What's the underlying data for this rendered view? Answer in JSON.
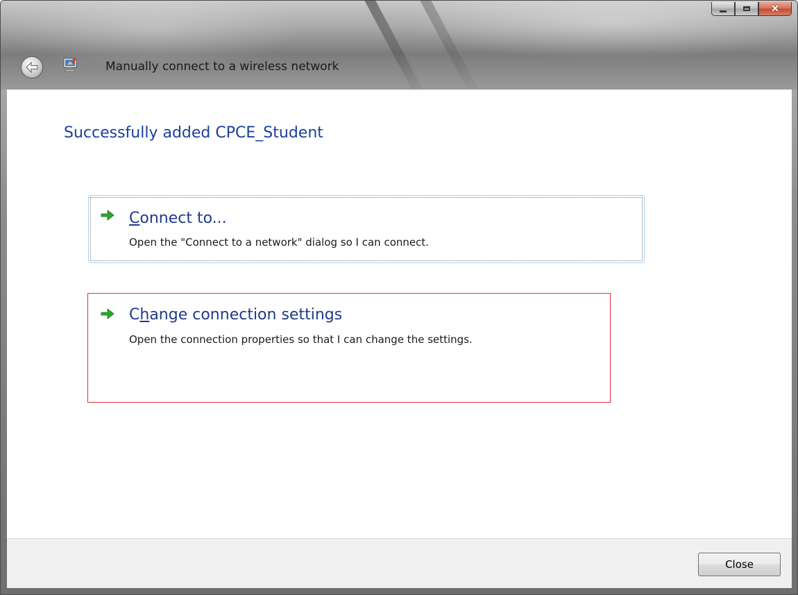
{
  "window": {
    "title": "Manually connect to a wireless network"
  },
  "icons": {
    "back": "back-arrow-icon",
    "app": "network-wizard-icon",
    "command_arrow": "green-arrow-icon"
  },
  "content": {
    "heading": "Successfully added CPCE_Student",
    "commands": [
      {
        "title_pre": "",
        "title_accel": "C",
        "title_post": "onnect to...",
        "description": "Open the \"Connect to a network\" dialog so I can connect."
      },
      {
        "title_pre": "C",
        "title_accel": "h",
        "title_post": "ange connection settings",
        "description": "Open the connection properties so that I can change the settings."
      }
    ]
  },
  "footer": {
    "close_label": "Close"
  },
  "colors": {
    "heading": "#1a3f9c",
    "highlight_border": "#e0323a",
    "command_arrow": "#2ea82e"
  }
}
